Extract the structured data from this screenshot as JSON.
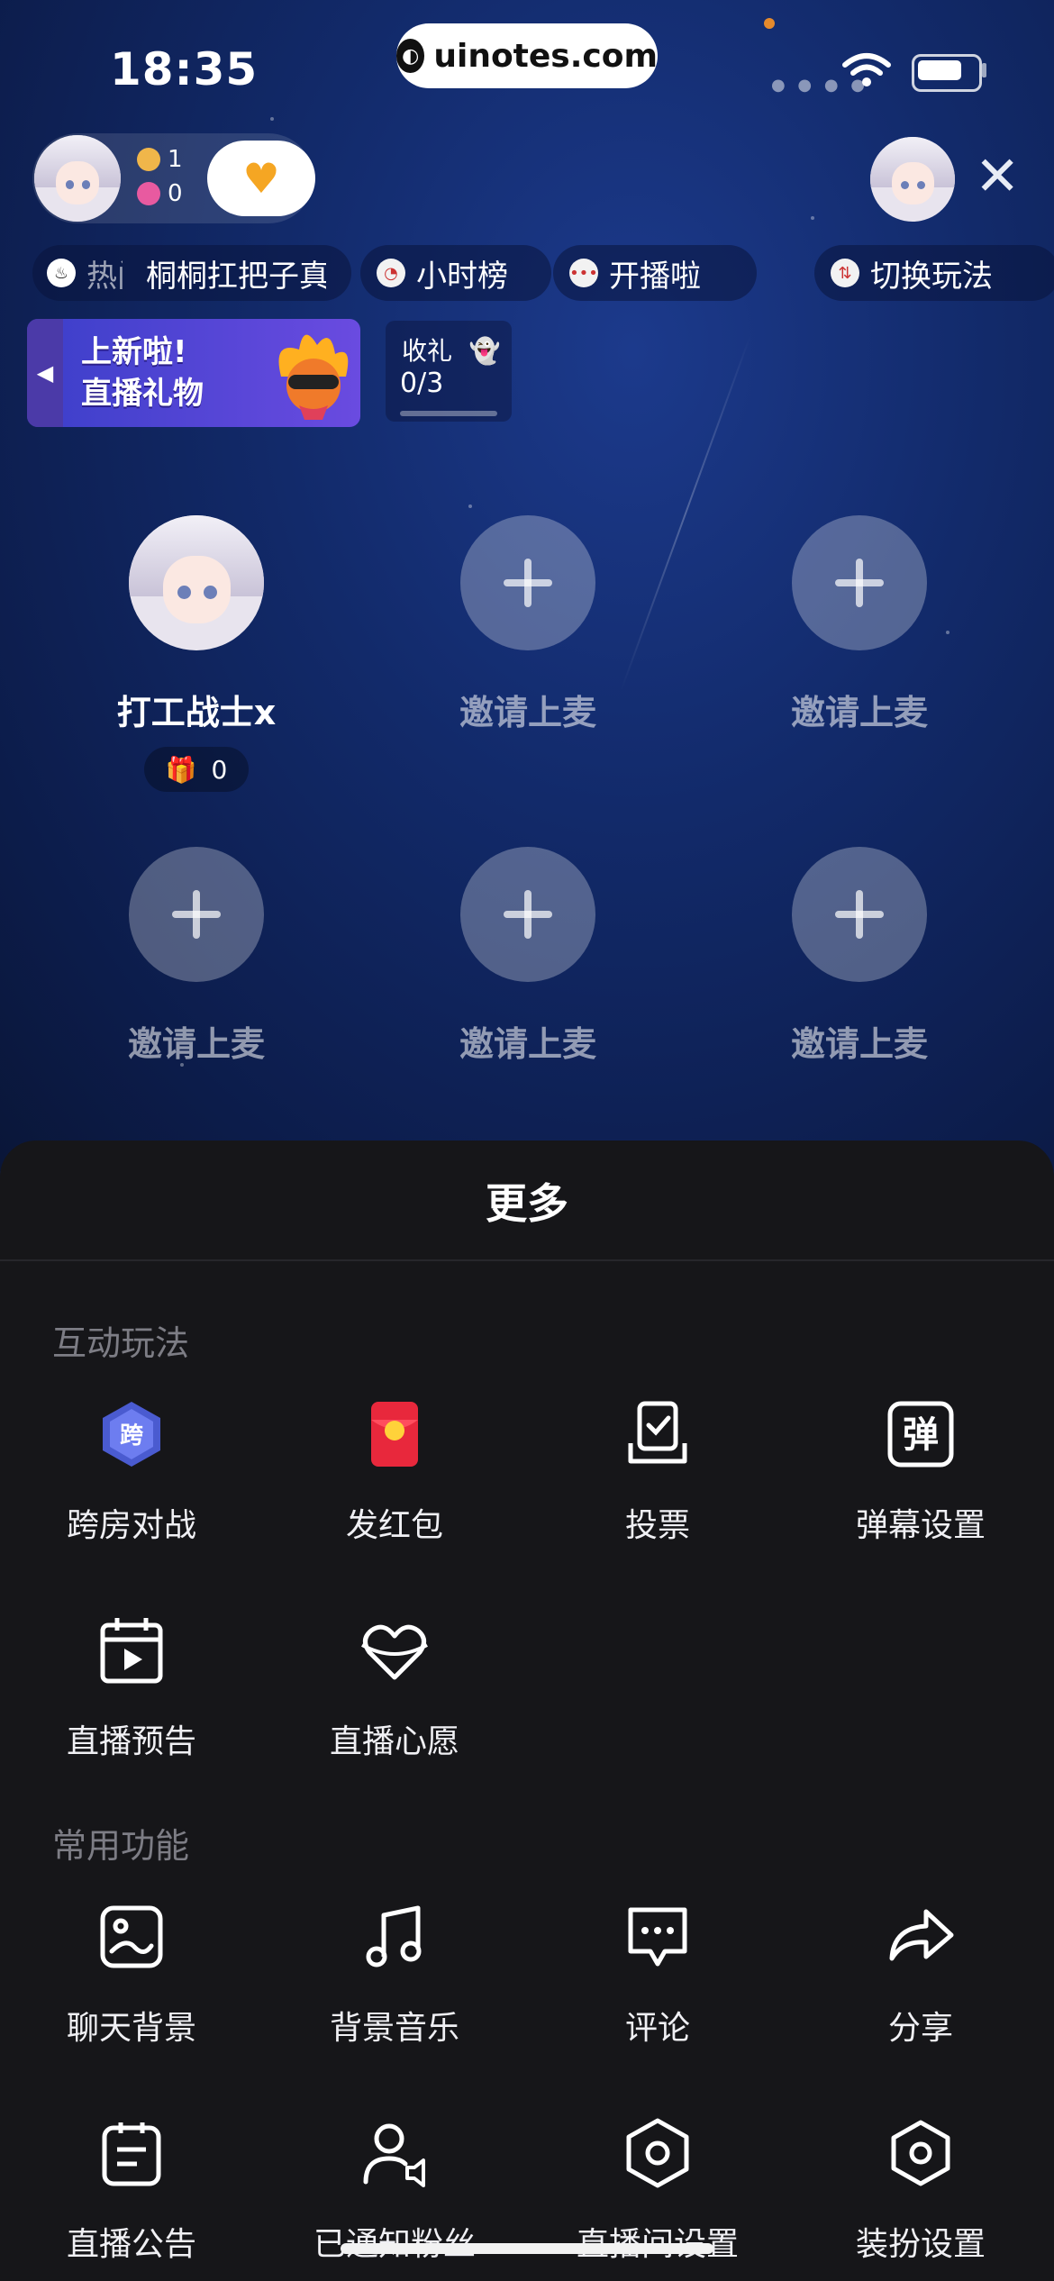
{
  "status_bar": {
    "time": "18:35",
    "url": "uinotes.com"
  },
  "host": {
    "online_count": "1",
    "like_count": "0"
  },
  "chips": {
    "hot_rank": "热门",
    "song": "桐桐扛把子真",
    "hour_rank": "小时榜",
    "start_live": "开播啦",
    "switch_mode": "切换玩法"
  },
  "banner": {
    "line1": "上新啦!",
    "line2": "直播礼物"
  },
  "gift_progress": {
    "title": "收礼",
    "value": "0/3",
    "fraction": 0.0
  },
  "seats": [
    {
      "label": "打工战士x",
      "gifts": "0",
      "occupied": true
    },
    {
      "label": "邀请上麦",
      "occupied": false
    },
    {
      "label": "邀请上麦",
      "occupied": false
    },
    {
      "label": "邀请上麦",
      "occupied": false
    },
    {
      "label": "邀请上麦",
      "occupied": false
    },
    {
      "label": "邀请上麦",
      "occupied": false
    }
  ],
  "sheet": {
    "title": "更多",
    "interactive_section": "互动玩法",
    "interactive_items": [
      {
        "label": "跨房对战",
        "icon": "cross-room-battle-icon"
      },
      {
        "label": "发红包",
        "icon": "red-envelope-icon"
      },
      {
        "label": "投票",
        "icon": "vote-icon"
      },
      {
        "label": "弹幕设置",
        "icon": "danmaku-icon"
      },
      {
        "label": "直播预告",
        "icon": "calendar-play-icon"
      },
      {
        "label": "直播心愿",
        "icon": "heart-wish-icon"
      }
    ],
    "common_section": "常用功能",
    "common_items": [
      {
        "label": "聊天背景",
        "icon": "chat-background-icon"
      },
      {
        "label": "背景音乐",
        "icon": "music-note-icon"
      },
      {
        "label": "评论",
        "icon": "comment-icon"
      },
      {
        "label": "分享",
        "icon": "share-arrow-icon"
      },
      {
        "label": "直播公告",
        "icon": "notice-icon"
      },
      {
        "label": "已通知粉丝",
        "icon": "notify-fans-icon"
      },
      {
        "label": "直播间设置",
        "icon": "room-settings-icon"
      },
      {
        "label": "装扮设置",
        "icon": "decoration-settings-icon"
      }
    ]
  },
  "colors": {
    "stage_blue": "#122a6a",
    "sheet_bg": "#161619",
    "red_envelope": "#e8283c"
  }
}
